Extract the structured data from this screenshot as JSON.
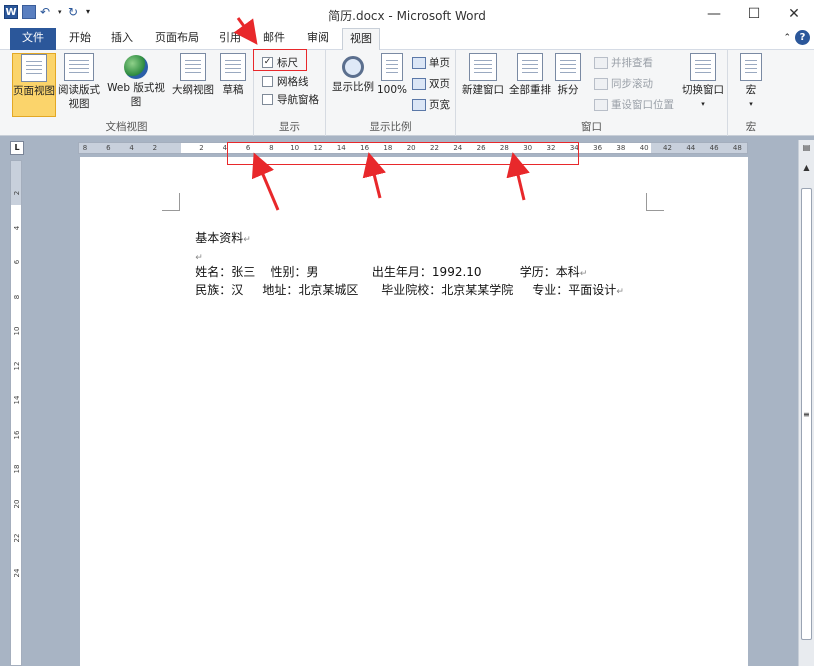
{
  "window": {
    "title": "简历.docx - Microsoft Word",
    "app_icon": "W",
    "minimize": "—",
    "maximize": "☐",
    "close": "✕"
  },
  "tabs": [
    {
      "label": "文件"
    },
    {
      "label": "开始"
    },
    {
      "label": "插入"
    },
    {
      "label": "页面布局"
    },
    {
      "label": "引用"
    },
    {
      "label": "邮件"
    },
    {
      "label": "审阅"
    },
    {
      "label": "视图"
    }
  ],
  "ribbon": {
    "doc_views": {
      "group_label": "文档视图",
      "print_layout": "页面视图",
      "reading_line1": "阅读版式",
      "reading_line2": "视图",
      "web": "Web 版式视图",
      "outline": "大纲视图",
      "draft": "草稿"
    },
    "show": {
      "group_label": "显示",
      "ruler": {
        "label": "标尺",
        "checked": true
      },
      "gridlines": {
        "label": "网格线",
        "checked": false
      },
      "nav_pane": {
        "label": "导航窗格",
        "checked": false
      }
    },
    "zoom": {
      "group_label": "显示比例",
      "zoom": "显示比例",
      "hundred": "100%",
      "one_page": "单页",
      "two_pages": "双页",
      "page_width": "页宽"
    },
    "window": {
      "group_label": "窗口",
      "new_window": "新建窗口",
      "arrange_all": "全部重排",
      "split": "拆分",
      "side_by_side": "并排查看",
      "sync_scroll": "同步滚动",
      "reset_position": "重设窗口位置",
      "switch_windows": "切换窗口"
    },
    "macros": {
      "group_label": "宏",
      "macros": "宏"
    }
  },
  "ruler_ticks": [
    "8",
    "6",
    "4",
    "2",
    "",
    "2",
    "4",
    "6",
    "8",
    "10",
    "12",
    "14",
    "16",
    "18",
    "20",
    "22",
    "24",
    "26",
    "28",
    "30",
    "32",
    "34",
    "36",
    "38",
    "40",
    "42",
    "44",
    "46",
    "48"
  ],
  "vruler_ticks": [
    "2",
    "4",
    "6",
    "8",
    "10",
    "12",
    "14",
    "16",
    "18",
    "20",
    "22",
    "24"
  ],
  "document": {
    "heading": "基本资料",
    "line1": "姓名：张三    性别：男              出生年月：1992.10          学历：本科",
    "line2": "民族：汉     地址：北京某城区      毕业院校：北京某某学院     专业：平面设计"
  },
  "colors": {
    "accent": "#2b579a",
    "selected": "#fbd46b",
    "annotation": "#e8282b"
  }
}
